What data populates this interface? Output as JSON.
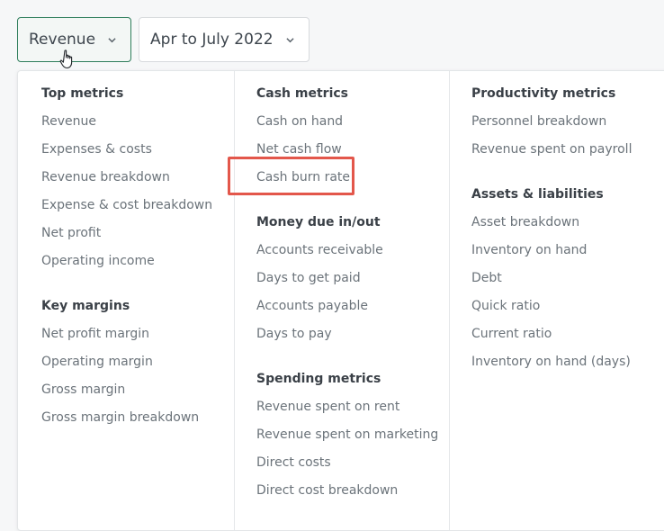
{
  "toolbar": {
    "metric_dropdown": {
      "label": "Revenue",
      "icon": "chevron-down-icon"
    },
    "period_dropdown": {
      "label": "Apr to July 2022",
      "icon": "chevron-down-icon"
    }
  },
  "colors": {
    "active_border": "#2e7d5b",
    "highlight": "#e3574b",
    "heading_text": "#3a4047",
    "item_text": "#6b737a"
  },
  "menu": {
    "col1": {
      "top_metrics": {
        "heading": "Top metrics",
        "items": [
          "Revenue",
          "Expenses & costs",
          "Revenue breakdown",
          "Expense & cost breakdown",
          "Net profit",
          "Operating income"
        ]
      },
      "key_margins": {
        "heading": "Key margins",
        "items": [
          "Net profit margin",
          "Operating margin",
          "Gross margin",
          "Gross margin breakdown"
        ]
      }
    },
    "col2": {
      "cash_metrics": {
        "heading": "Cash metrics",
        "items": [
          "Cash on hand",
          "Net cash flow",
          "Cash burn rate"
        ]
      },
      "money_due": {
        "heading": "Money due in/out",
        "items": [
          "Accounts receivable",
          "Days to get paid",
          "Accounts payable",
          "Days to pay"
        ]
      },
      "spending_metrics": {
        "heading": "Spending metrics",
        "items": [
          "Revenue spent on rent",
          "Revenue spent on marketing",
          "Direct costs",
          "Direct cost breakdown"
        ]
      }
    },
    "col3": {
      "productivity_metrics": {
        "heading": "Productivity metrics",
        "items": [
          "Personnel breakdown",
          "Revenue spent on payroll"
        ]
      },
      "assets_liabilities": {
        "heading": "Assets & liabilities",
        "items": [
          "Asset breakdown",
          "Inventory on hand",
          "Debt",
          "Quick ratio",
          "Current ratio",
          "Inventory on hand (days)"
        ]
      }
    }
  }
}
